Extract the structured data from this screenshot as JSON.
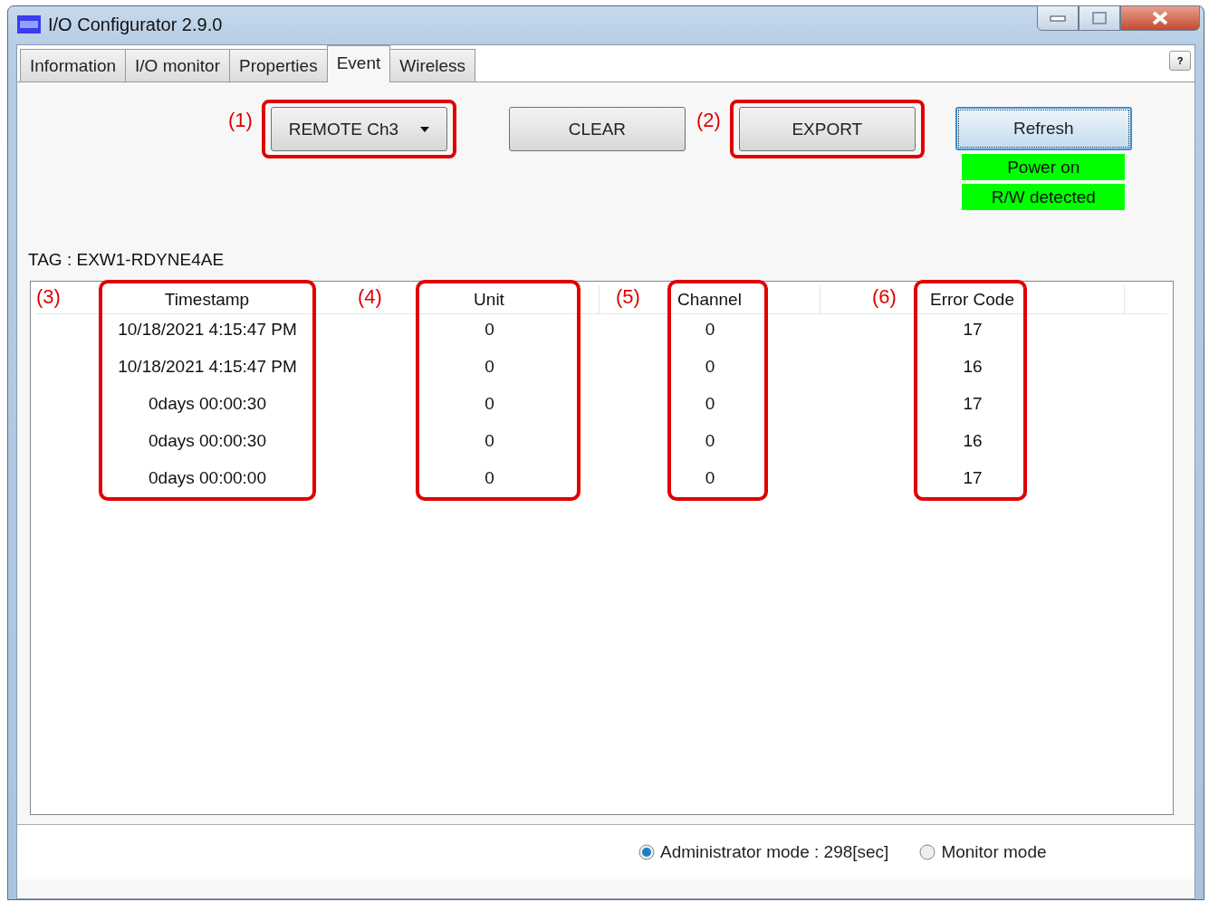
{
  "window": {
    "title": "I/O Configurator 2.9.0"
  },
  "tabs": [
    {
      "label": "Information",
      "selected": false
    },
    {
      "label": "I/O monitor",
      "selected": false
    },
    {
      "label": "Properties",
      "selected": false
    },
    {
      "label": "Event",
      "selected": true
    },
    {
      "label": "Wireless",
      "selected": false
    }
  ],
  "help_button": "?",
  "toolbar": [
    {
      "kind": "dropdown",
      "label": "REMOTE Ch3",
      "marker": "(1)",
      "highlighted": true
    },
    {
      "kind": "button",
      "label": "CLEAR",
      "highlighted": false
    },
    {
      "kind": "button",
      "label": "EXPORT",
      "marker": "(2)",
      "highlighted": true
    }
  ],
  "refresh_button": "Refresh",
  "status_indicators": [
    "Power on",
    "R/W detected"
  ],
  "tag": "TAG : EXW1-RDYNE4AE",
  "table": {
    "columns": [
      {
        "label": "Timestamp",
        "marker": "(3)",
        "highlighted": true
      },
      {
        "label": "Unit",
        "marker": "(4)",
        "highlighted": true
      },
      {
        "label": "Channel",
        "marker": "(5)",
        "highlighted": true
      },
      {
        "label": "Error Code",
        "marker": "(6)",
        "highlighted": true
      }
    ],
    "rows": [
      [
        "10/18/2021 4:15:47 PM",
        "0",
        "0",
        "17"
      ],
      [
        "10/18/2021 4:15:47 PM",
        "0",
        "0",
        "16"
      ],
      [
        "0days 00:00:30",
        "0",
        "0",
        "17"
      ],
      [
        "0days 00:00:30",
        "0",
        "0",
        "16"
      ],
      [
        "0days 00:00:00",
        "0",
        "0",
        "17"
      ]
    ]
  },
  "modes": [
    {
      "label": "Administrator mode : 298[sec]",
      "selected": true
    },
    {
      "label": "Monitor mode",
      "selected": false
    }
  ]
}
